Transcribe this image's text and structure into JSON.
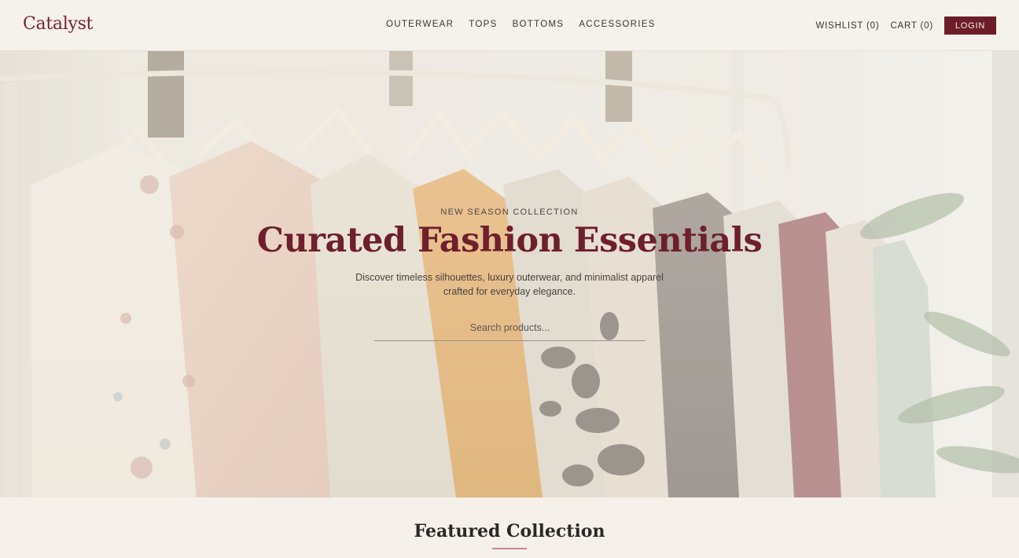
{
  "brand": {
    "logo": "Catalyst",
    "accent": "#6d1c2a"
  },
  "nav": {
    "items": [
      {
        "label": "OUTERWEAR"
      },
      {
        "label": "TOPS"
      },
      {
        "label": "BOTTOMS"
      },
      {
        "label": "ACCESSORIES"
      }
    ]
  },
  "header": {
    "wishlist": "WISHLIST (0)",
    "cart": "CART (0)",
    "login": "LOGIN"
  },
  "hero": {
    "eyebrow": "NEW SEASON COLLECTION",
    "title": "Curated Fashion Essentials",
    "subtitle": "Discover timeless silhouettes, luxury outerwear, and minimalist apparel crafted for everyday elegance.",
    "search_placeholder": "Search products...",
    "search_value": ""
  },
  "featured": {
    "title": "Featured Collection"
  }
}
